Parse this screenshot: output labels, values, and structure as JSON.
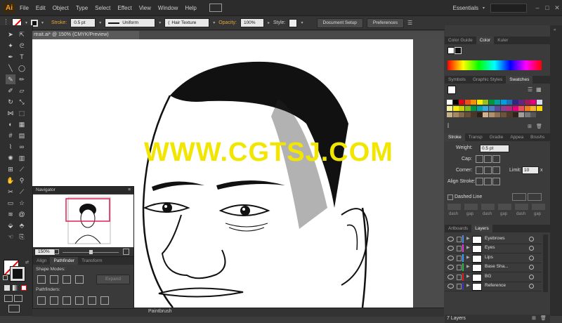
{
  "app": {
    "logo": "Ai",
    "workspace": "Essentials",
    "search_icon": "search-icon"
  },
  "menu": [
    "File",
    "Edit",
    "Object",
    "Type",
    "Select",
    "Effect",
    "View",
    "Window",
    "Help"
  ],
  "control_bar": {
    "stroke_label": "Stroke:",
    "stroke_value": "0.5 pt",
    "profile": "Uniform",
    "brush": "Hair Texture",
    "opacity_label": "Opacity:",
    "opacity_value": "100%",
    "style_label": "Style:",
    "document_setup": "Document Setup",
    "preferences": "Preferences"
  },
  "document": {
    "tab_title": "rtrait.ai* @ 150% (CMYK/Preview)",
    "status_tool": "Paintbrush"
  },
  "watermark": "WWW.CGTSJ.COM",
  "navigator": {
    "title": "Navigator",
    "zoom": "150%"
  },
  "pathfinder_panel": {
    "tabs": [
      "Align",
      "Pathfinder",
      "Transform"
    ],
    "active_tab": "Pathfinder",
    "shape_modes": "Shape Modes:",
    "pathfinders": "Pathfinders:",
    "expand": "Expand"
  },
  "color_panel": {
    "tabs": [
      "Color Guide",
      "Color",
      "Kuler"
    ],
    "active_tab": "Color"
  },
  "swatches_panel": {
    "tabs": [
      "Symbols",
      "Graphic Styles",
      "Swatches"
    ],
    "active_tab": "Swatches",
    "colors": [
      "#ffffff",
      "#000000",
      "#e2001a",
      "#e94e1b",
      "#f39200",
      "#ffed00",
      "#95c11f",
      "#009640",
      "#00a19a",
      "#009ee3",
      "#1d71b8",
      "#312783",
      "#662483",
      "#a3195b",
      "#e6007e",
      "#d4dcee",
      "#f7f4a6",
      "#fcea10",
      "#c6d300",
      "#83b819",
      "#009846",
      "#00a3a8",
      "#36a9e1",
      "#4e7fc0",
      "#5a4a9c",
      "#8a3f92",
      "#b7287f",
      "#e5007d",
      "#ea5163",
      "#ef7f1a",
      "#f6b32b",
      "#fdd900",
      "#c8b186",
      "#a58a5f",
      "#85694a",
      "#664e37",
      "#4a3626",
      "#2e2013",
      "#d0b38c",
      "#b09169",
      "#8e7050",
      "#6e533a",
      "#50392a",
      "#332216",
      "#a19f9e",
      "#7a7979",
      "#575656",
      "#3a3a3a"
    ]
  },
  "stroke_panel": {
    "tabs": [
      "Stroke",
      "Transp",
      "Gradie",
      "Appea",
      "Brushs"
    ],
    "active_tab": "Stroke",
    "weight_label": "Weight:",
    "weight_value": "0.5 pt",
    "cap_label": "Cap:",
    "corner_label": "Corner:",
    "limit_label": "Limit:",
    "limit_value": "10",
    "limit_unit": "x",
    "align_label": "Align Stroke:",
    "dashed_line": "Dashed Line",
    "dash_labels": [
      "dash",
      "gap",
      "dash",
      "gap",
      "dash",
      "gap"
    ]
  },
  "layers_panel": {
    "tabs": [
      "Artboards",
      "Layers"
    ],
    "active_tab": "Layers",
    "layers": [
      {
        "name": "Eyebrows",
        "color": "#4a8fe0"
      },
      {
        "name": "Eyes",
        "color": "#e03ad8"
      },
      {
        "name": "Lips",
        "color": "#3aa0ff"
      },
      {
        "name": "Base Sha...",
        "color": "#28c040"
      },
      {
        "name": "BG",
        "color": "#e02020"
      },
      {
        "name": "Reference",
        "color": "#3a3ab8"
      }
    ],
    "count": "7 Layers"
  }
}
